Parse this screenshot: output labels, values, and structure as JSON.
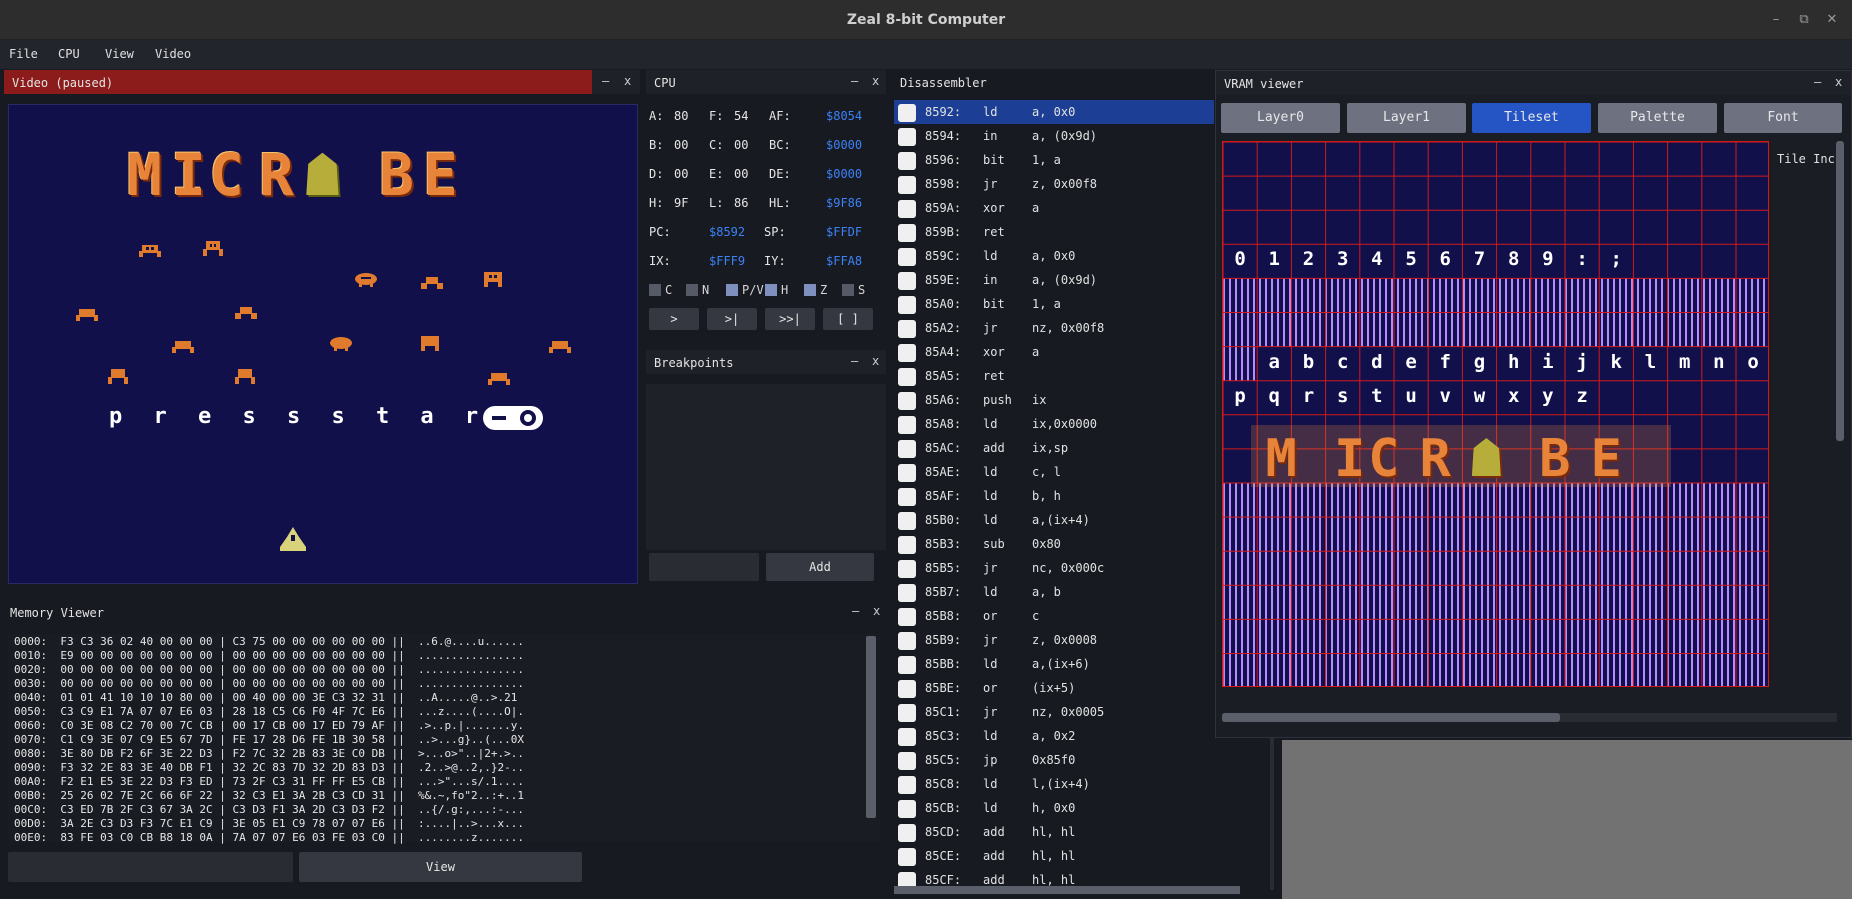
{
  "window": {
    "title": "Zeal 8-bit Computer",
    "minimize": "–",
    "maximize": "⧉",
    "close": "✕"
  },
  "menu": [
    "File",
    "CPU",
    "View",
    "Video"
  ],
  "video_panel": {
    "title": "Video (paused)",
    "min": "–",
    "close": "x",
    "logo_letters": [
      "M",
      "I",
      "C",
      "R",
      "☗",
      "B",
      "E"
    ],
    "press_text": "p r e s s   s t a r t"
  },
  "cpu_panel": {
    "title": "CPU",
    "min": "–",
    "close": "x",
    "registers": [
      {
        "label": "A:",
        "value": "80"
      },
      {
        "label": "F:",
        "value": "54"
      },
      {
        "label": "AF:",
        "value": "$8054"
      },
      {
        "label": "B:",
        "value": "00"
      },
      {
        "label": "C:",
        "value": "00"
      },
      {
        "label": "BC:",
        "value": "$0000"
      },
      {
        "label": "D:",
        "value": "00"
      },
      {
        "label": "E:",
        "value": "00"
      },
      {
        "label": "DE:",
        "value": "$0000"
      },
      {
        "label": "H:",
        "value": "9F"
      },
      {
        "label": "L:",
        "value": "86"
      },
      {
        "label": "HL:",
        "value": "$9F86"
      },
      {
        "label": "PC:",
        "value": "$8592"
      },
      {
        "label": "SP:",
        "value": "$FFDF"
      },
      {
        "label": "IX:",
        "value": "$FFF9"
      },
      {
        "label": "IY:",
        "value": "$FFA8"
      }
    ],
    "flags": [
      "C",
      "N",
      "P/V",
      "H",
      "Z",
      "S"
    ],
    "controls": [
      ">",
      ">|",
      ">>|",
      "[ ]"
    ]
  },
  "breakpoints_panel": {
    "title": "Breakpoints",
    "min": "–",
    "close": "x",
    "add_label": "Add"
  },
  "disassembler": {
    "title": "Disassembler",
    "rows": [
      {
        "addr": "8592:",
        "mn": "ld",
        "op": "a, 0x0"
      },
      {
        "addr": "8594:",
        "mn": "in",
        "op": "a, (0x9d)"
      },
      {
        "addr": "8596:",
        "mn": "bit",
        "op": "1, a"
      },
      {
        "addr": "8598:",
        "mn": "jr",
        "op": "z, 0x00f8"
      },
      {
        "addr": "859A:",
        "mn": "xor",
        "op": "a"
      },
      {
        "addr": "859B:",
        "mn": "ret",
        "op": ""
      },
      {
        "addr": "859C:",
        "mn": "ld",
        "op": "a, 0x0"
      },
      {
        "addr": "859E:",
        "mn": "in",
        "op": "a, (0x9d)"
      },
      {
        "addr": "85A0:",
        "mn": "bit",
        "op": "1, a"
      },
      {
        "addr": "85A2:",
        "mn": "jr",
        "op": "nz, 0x00f8"
      },
      {
        "addr": "85A4:",
        "mn": "xor",
        "op": "a"
      },
      {
        "addr": "85A5:",
        "mn": "ret",
        "op": ""
      },
      {
        "addr": "85A6:",
        "mn": "push",
        "op": "ix"
      },
      {
        "addr": "85A8:",
        "mn": "ld",
        "op": "ix,0x0000"
      },
      {
        "addr": "85AC:",
        "mn": "add",
        "op": "ix,sp"
      },
      {
        "addr": "85AE:",
        "mn": "ld",
        "op": "c, l"
      },
      {
        "addr": "85AF:",
        "mn": "ld",
        "op": "b, h"
      },
      {
        "addr": "85B0:",
        "mn": "ld",
        "op": "a,(ix+4)"
      },
      {
        "addr": "85B3:",
        "mn": "sub",
        "op": "0x80"
      },
      {
        "addr": "85B5:",
        "mn": "jr",
        "op": "nc, 0x000c"
      },
      {
        "addr": "85B7:",
        "mn": "ld",
        "op": "a, b"
      },
      {
        "addr": "85B8:",
        "mn": "or",
        "op": "c"
      },
      {
        "addr": "85B9:",
        "mn": "jr",
        "op": "z, 0x0008"
      },
      {
        "addr": "85BB:",
        "mn": "ld",
        "op": "a,(ix+6)"
      },
      {
        "addr": "85BE:",
        "mn": "or",
        "op": "(ix+5)"
      },
      {
        "addr": "85C1:",
        "mn": "jr",
        "op": "nz, 0x0005"
      },
      {
        "addr": "85C3:",
        "mn": "ld",
        "op": "a, 0x2"
      },
      {
        "addr": "85C5:",
        "mn": "jp",
        "op": "0x85f0"
      },
      {
        "addr": "85C8:",
        "mn": "ld",
        "op": "l,(ix+4)"
      },
      {
        "addr": "85CB:",
        "mn": "ld",
        "op": "h, 0x0"
      },
      {
        "addr": "85CD:",
        "mn": "add",
        "op": "hl, hl"
      },
      {
        "addr": "85CE:",
        "mn": "add",
        "op": "hl, hl"
      },
      {
        "addr": "85CF:",
        "mn": "add",
        "op": "hl, hl"
      }
    ]
  },
  "memory_viewer": {
    "title": "Memory Viewer",
    "min": "–",
    "close": "x",
    "view_label": "View",
    "lines": [
      "0000:  F3 C3 36 02 40 00 00 00 | C3 75 00 00 00 00 00 00 ||  ..6.@....u......",
      "0010:  E9 00 00 00 00 00 00 00 | 00 00 00 00 00 00 00 00 ||  ................",
      "0020:  00 00 00 00 00 00 00 00 | 00 00 00 00 00 00 00 00 ||  ................",
      "0030:  00 00 00 00 00 00 00 00 | 00 00 00 00 00 00 00 00 ||  ................",
      "0040:  01 01 41 10 10 10 80 00 | 00 40 00 00 3E C3 32 31 ||  ..A.....@..>.21",
      "0050:  C3 C9 E1 7A 07 07 E6 03 | 28 18 C5 C6 F0 4F 7C E6 ||  ...z....(....O|.",
      "0060:  C0 3E 08 C2 70 00 7C CB | 00 17 CB 00 17 ED 79 AF ||  .>..p.|.......y.",
      "0070:  C1 C9 3E 07 C9 E5 67 7D | FE 17 28 D6 FE 1B 30 58 ||  ..>...g}..(...0X",
      "0080:  3E 80 DB F2 6F 3E 22 D3 | F2 7C 32 2B 83 3E C0 DB ||  >...o>\"..|2+.>..",
      "0090:  F3 32 2E 83 3E 40 DB F1 | 32 2C 83 7D 32 2D 83 D3 ||  .2..>@..2,.}2-..",
      "00A0:  F2 E1 E5 3E 22 D3 F3 ED | 73 2F C3 31 FF FF E5 CB ||  ...>\"...s/.1....",
      "00B0:  25 26 02 7E 2C 66 6F 22 | 32 C3 E1 3A 2B C3 CD 31 ||  %&.~,fo\"2..:+..1",
      "00C0:  C3 ED 7B 2F C3 67 3A 2C | C3 D3 F1 3A 2D C3 D3 F2 ||  ..{/.g:,...:-...",
      "00D0:  3A 2E C3 D3 F3 7C E1 C9 | 3E 05 E1 C9 78 07 07 E6 ||  :....|..>...x...",
      "00E0:  83 FE 03 C0 CB B8 18 0A | 7A 07 07 E6 03 FE 03 C0 ||  ........z......."
    ]
  },
  "vram_viewer": {
    "title": "VRAM viewer",
    "min": "–",
    "close": "x",
    "tabs": [
      "Layer0",
      "Layer1",
      "Tileset",
      "Palette",
      "Font"
    ],
    "active_tab": "Tileset",
    "side_label": "Tile Inc",
    "digits_row": [
      "0",
      "1",
      "2",
      "3",
      "4",
      "5",
      "6",
      "7",
      "8",
      "9",
      ":",
      ";"
    ],
    "letters_row1": [
      "a",
      "b",
      "c",
      "d",
      "e",
      "f",
      "g",
      "h",
      "i",
      "j",
      "k",
      "l",
      "m",
      "n",
      "o"
    ],
    "letters_row2": [
      "p",
      "q",
      "r",
      "s",
      "t",
      "u",
      "v",
      "w",
      "x",
      "y",
      "z"
    ]
  }
}
